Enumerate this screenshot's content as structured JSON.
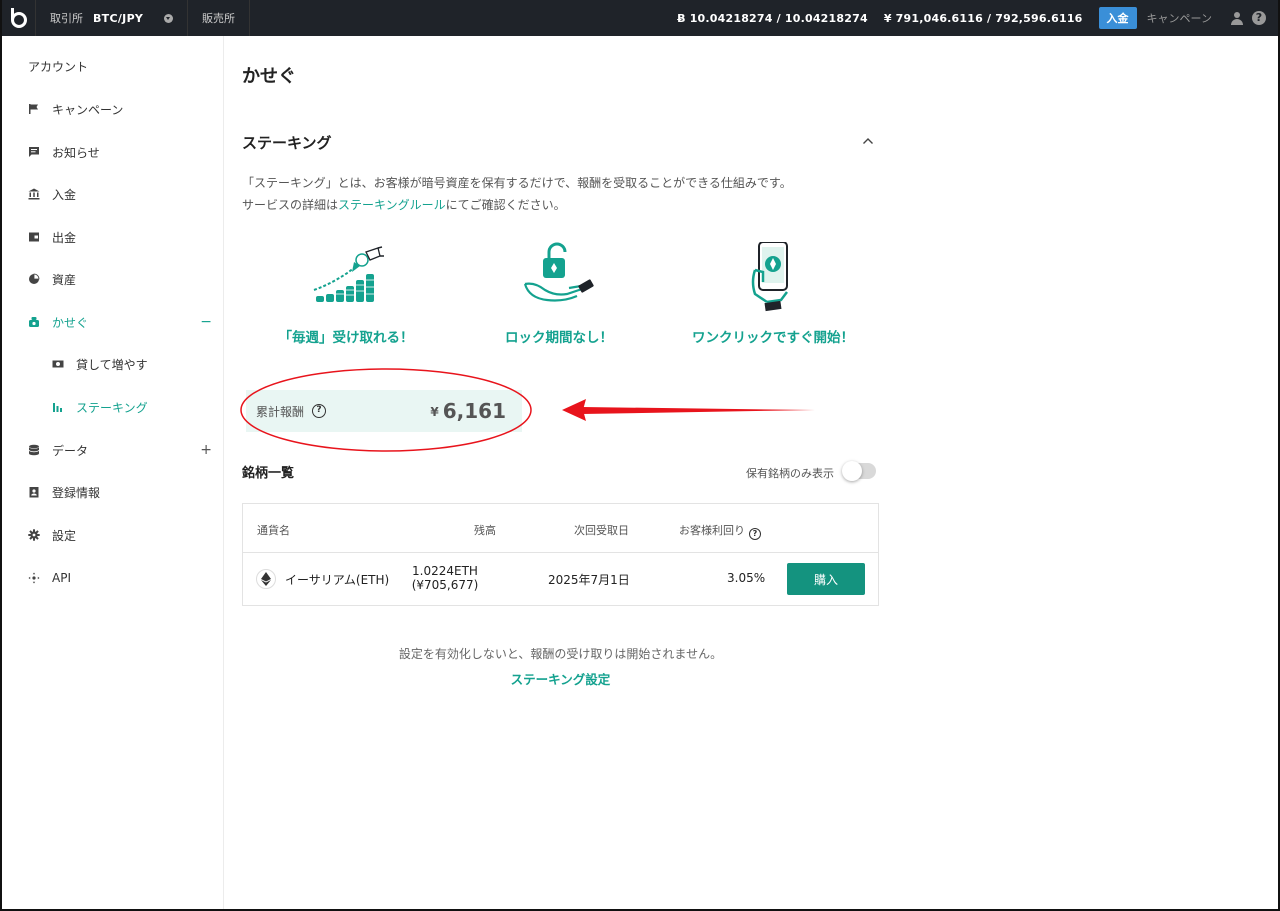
{
  "topbar": {
    "exchange_label": "取引所",
    "pair": "BTC/JPY",
    "sales_label": "販売所",
    "btc_currency": "Ƀ",
    "btc_balance": "10.04218274 / 10.04218274",
    "jpy_currency": "¥",
    "jpy_balance": "791,046.6116 / 792,596.6116",
    "deposit_label": "入金",
    "campaign_label": "キャンペーン",
    "help_glyph": "?"
  },
  "sidebar": {
    "title": "アカウント",
    "items": [
      {
        "label": "キャンペーン",
        "icon": "flag-icon"
      },
      {
        "label": "お知らせ",
        "icon": "message-icon"
      },
      {
        "label": "入金",
        "icon": "bank-icon"
      },
      {
        "label": "出金",
        "icon": "wallet-icon"
      },
      {
        "label": "資産",
        "icon": "pie-chart-icon"
      },
      {
        "label": "かせぐ",
        "icon": "earn-icon",
        "sign": "−"
      },
      {
        "label": "貸して増やす",
        "icon": "lending-icon"
      },
      {
        "label": "ステーキング",
        "icon": "staking-icon"
      },
      {
        "label": "データ",
        "icon": "database-icon",
        "sign": "+"
      },
      {
        "label": "登録情報",
        "icon": "id-card-icon"
      },
      {
        "label": "設定",
        "icon": "gear-icon"
      },
      {
        "label": "API",
        "icon": "api-icon"
      }
    ]
  },
  "main": {
    "page_title": "かせぐ",
    "section_title": "ステーキング",
    "desc_line1": "「ステーキング」とは、お客様が暗号資産を保有するだけで、報酬を受取ることができる仕組みです。",
    "desc_line2_prefix": "サービスの詳細は",
    "desc_line2_link": "ステーキングルール",
    "desc_line2_suffix": "にてご確認ください。",
    "features": [
      {
        "label": "「毎週」受け取れる！",
        "icon": "coins-growth-icon"
      },
      {
        "label": "ロック期間なし！",
        "icon": "unlock-hand-icon"
      },
      {
        "label": "ワンクリックですぐ開始！",
        "icon": "phone-tap-icon"
      }
    ],
    "reward_label": "累計報酬",
    "reward_help": "?",
    "reward_currency": "¥",
    "reward_amount": "6,161",
    "list_title": "銘柄一覧",
    "toggle_label": "保有銘柄のみ表示",
    "table": {
      "headers": [
        "通貨名",
        "残高",
        "次回受取日",
        "お客様利回り"
      ],
      "help": "?",
      "rows": [
        {
          "coin": "イーサリアム(ETH)",
          "balance": "1.0224ETH",
          "balance_jpy": "(¥705,677)",
          "next_date": "2025年7月1日",
          "rate": "3.05%",
          "button": "購入"
        }
      ]
    },
    "note": "設定を有効化しないと、報酬の受け取りは開始されません。",
    "settings_link": "ステーキング設定"
  },
  "colors": {
    "accent": "#14a28f",
    "topbar": "#1f2329",
    "deposit": "#3a8fd8",
    "annotation": "#e8141c"
  }
}
